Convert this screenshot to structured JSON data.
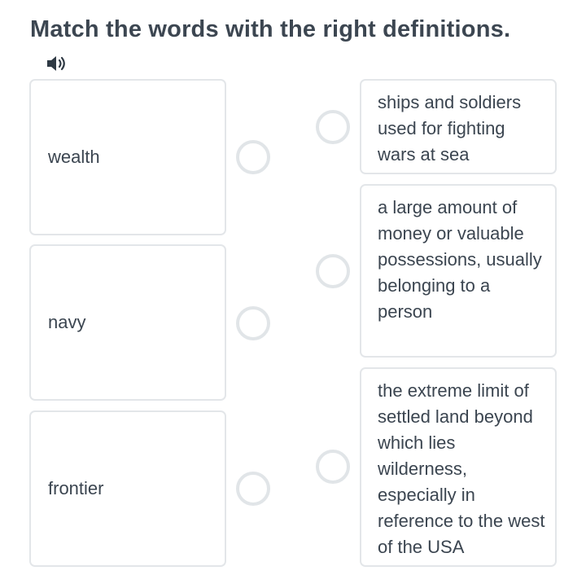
{
  "exercise": {
    "title": "Match the words with the right definitions.",
    "audio_icon": "speaker-icon"
  },
  "words": [
    {
      "label": "wealth"
    },
    {
      "label": "navy"
    },
    {
      "label": "frontier"
    }
  ],
  "definitions": [
    {
      "label": "ships and soldiers used for fighting wars at sea"
    },
    {
      "label": "a large amount of money or valuable possessions, usually belonging to a person"
    },
    {
      "label": "the extreme limit of settled land beyond which lies wilderness, especially in reference to the west of the USA"
    }
  ],
  "colors": {
    "text": "#3b4550",
    "border": "#e3e6e9",
    "radio_border": "#e1e5e8"
  }
}
